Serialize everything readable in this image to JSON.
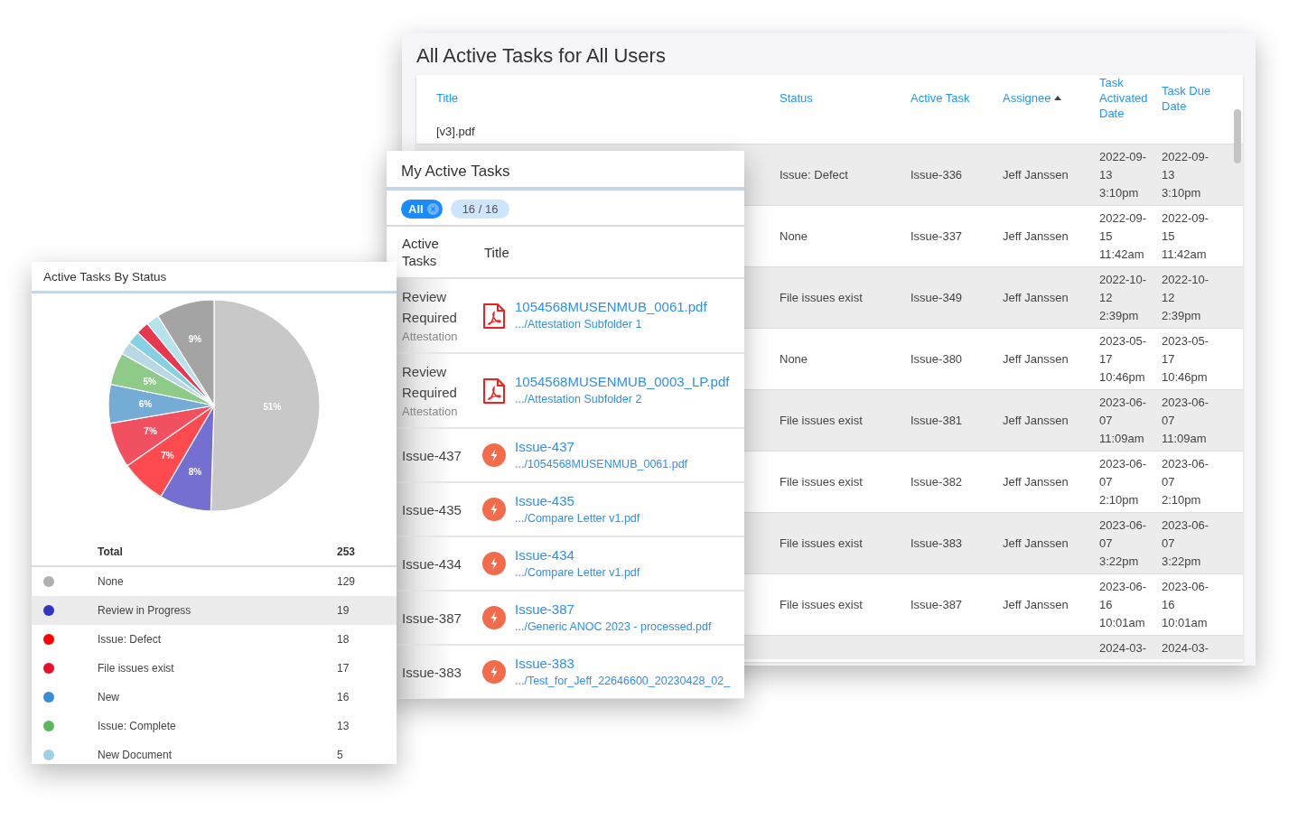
{
  "all_tasks": {
    "title": "All Active Tasks for All Users",
    "columns": [
      {
        "label": "Title",
        "sorted": false
      },
      {
        "label": "Status",
        "sorted": false
      },
      {
        "label": "Active Task",
        "sorted": false
      },
      {
        "label": "Assignee",
        "sorted": true
      },
      {
        "label": "Task Activated Date",
        "sorted": false
      },
      {
        "label": "Task Due Date",
        "sorted": false
      }
    ],
    "partial_row_title": "[v3].pdf",
    "rows": [
      {
        "status": "Issue: Defect",
        "active_task": "Issue-336",
        "assignee": "Jeff Janssen",
        "activated": "2022-09-13 3:10pm",
        "due": "2022-09-13 3:10pm"
      },
      {
        "status": "None",
        "active_task": "Issue-337",
        "assignee": "Jeff Janssen",
        "activated": "2022-09-15 11:42am",
        "due": "2022-09-15 11:42am"
      },
      {
        "status": "File issues exist",
        "active_task": "Issue-349",
        "assignee": "Jeff Janssen",
        "activated": "2022-10-12 2:39pm",
        "due": "2022-10-12 2:39pm"
      },
      {
        "status": "None",
        "active_task": "Issue-380",
        "assignee": "Jeff Janssen",
        "activated": "2023-05-17 10:46pm",
        "due": "2023-05-17 10:46pm"
      },
      {
        "status": "File issues exist",
        "active_task": "Issue-381",
        "assignee": "Jeff Janssen",
        "activated": "2023-06-07 11:09am",
        "due": "2023-06-07 11:09am"
      },
      {
        "status": "File issues exist",
        "active_task": "Issue-382",
        "assignee": "Jeff Janssen",
        "activated": "2023-06-07 2:10pm",
        "due": "2023-06-07 2:10pm"
      },
      {
        "status": "File issues exist",
        "active_task": "Issue-383",
        "assignee": "Jeff Janssen",
        "activated": "2023-06-07 3:22pm",
        "due": "2023-06-07 3:22pm"
      },
      {
        "status": "File issues exist",
        "active_task": "Issue-387",
        "assignee": "Jeff Janssen",
        "activated": "2023-06-16 10:01am",
        "due": "2023-06-16 10:01am"
      }
    ],
    "cut_row": {
      "activated": "2024-03-",
      "due": "2024-03-"
    }
  },
  "my_tasks": {
    "title": "My Active Tasks",
    "filters": [
      {
        "label": "All",
        "selected": true,
        "removable": true
      },
      {
        "label": "16 / 16",
        "selected": false,
        "removable": false
      }
    ],
    "columns": [
      "Active Tasks",
      "Title"
    ],
    "rows": [
      {
        "kind": "file",
        "task": "Review Required",
        "task_sub": "Attestation",
        "title": "1054568MUSENMUB_0061.pdf",
        "path": ".../Attestation Subfolder 1"
      },
      {
        "kind": "file",
        "task": "Review Required",
        "task_sub": "Attestation",
        "title": "1054568MUSENMUB_0003_LP.pdf",
        "path": ".../Attestation Subfolder 2"
      },
      {
        "kind": "issue",
        "task": "Issue-437",
        "title": "Issue-437",
        "path": ".../1054568MUSENMUB_0061.pdf"
      },
      {
        "kind": "issue",
        "task": "Issue-435",
        "title": "Issue-435",
        "path": ".../Compare Letter v1.pdf"
      },
      {
        "kind": "issue",
        "task": "Issue-434",
        "title": "Issue-434",
        "path": ".../Compare Letter v1.pdf"
      },
      {
        "kind": "issue",
        "task": "Issue-387",
        "title": "Issue-387",
        "path": ".../Generic ANOC 2023 - processed.pdf"
      },
      {
        "kind": "issue",
        "task": "Issue-383",
        "title": "Issue-383",
        "path": ".../Test_for_Jeff_22646600_20230428_02_"
      }
    ]
  },
  "by_status": {
    "title": "Active Tasks By Status",
    "chart_data": {
      "type": "pie",
      "values": [
        51,
        8,
        7,
        7,
        6,
        5,
        2,
        2,
        2,
        2,
        9
      ],
      "colors": [
        "#c8c8c8",
        "#7370d2",
        "#ff4b4f",
        "#f0505f",
        "#74acd6",
        "#8ecb88",
        "#b7d8e4",
        "#86d0e4",
        "#e8384f",
        "#b6e2ec",
        "#a4a4a4"
      ],
      "value_labels": [
        "51%",
        "8%",
        "7%",
        "7%",
        "6%",
        "5%",
        null,
        null,
        null,
        null,
        "9%"
      ]
    },
    "total": {
      "label": "Total",
      "count": "253"
    },
    "statuses": [
      {
        "name": "None",
        "count": "129",
        "color": "#b0b0b0",
        "selected": false
      },
      {
        "name": "Review in Progress",
        "count": "19",
        "color": "#3333c4",
        "selected": true
      },
      {
        "name": "Issue: Defect",
        "count": "18",
        "color": "#ff0000",
        "selected": false
      },
      {
        "name": "File issues exist",
        "count": "17",
        "color": "#e8102e",
        "selected": false
      },
      {
        "name": "New",
        "count": "16",
        "color": "#3a8dd0",
        "selected": false
      },
      {
        "name": "Issue: Complete",
        "count": "13",
        "color": "#5cb85c",
        "selected": false
      },
      {
        "name": "New Document",
        "count": "5",
        "color": "#9ecfe6",
        "selected": false
      }
    ]
  }
}
